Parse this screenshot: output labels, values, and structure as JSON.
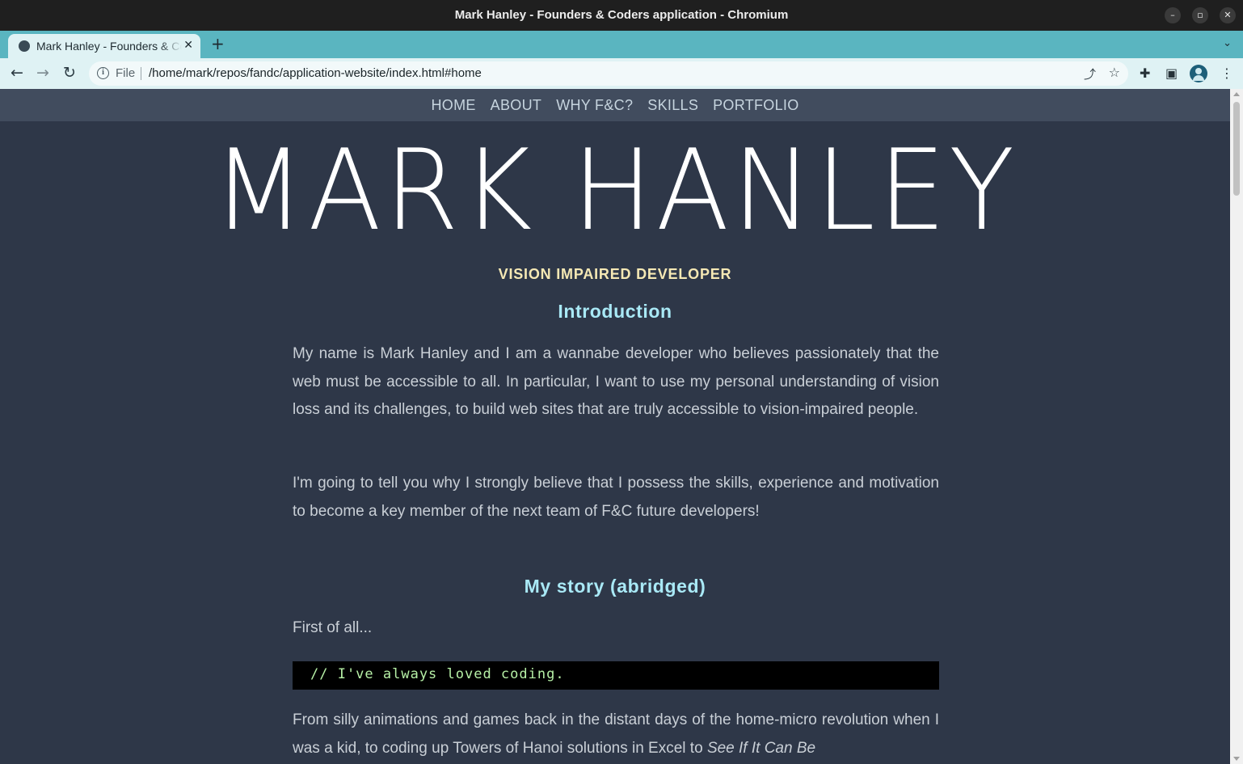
{
  "window": {
    "title": "Mark Hanley - Founders & Coders application - Chromium",
    "minimize_glyph": "–",
    "maximize_glyph": "▫",
    "close_glyph": "✕"
  },
  "tabs": [
    {
      "label": "Mark Hanley - Founders & Coders application",
      "close_glyph": "✕"
    }
  ],
  "tabstrip": {
    "new_tab_glyph": "+",
    "tab_search_glyph": "⌄"
  },
  "toolbar": {
    "back_glyph": "←",
    "forward_glyph": "→",
    "reload_glyph": "↻",
    "scheme_label": "File",
    "url": "/home/mark/repos/fandc/application-website/index.html#home",
    "share_glyph": "⤴",
    "bookmark_glyph": "☆",
    "extensions_glyph": "✚",
    "sidepanel_glyph": "▣",
    "menu_glyph": "⋮"
  },
  "site_nav": {
    "items": [
      "HOME",
      "ABOUT",
      "WHY F&C?",
      "SKILLS",
      "PORTFOLIO"
    ]
  },
  "hero": {
    "name": "MARK HANLEY",
    "subtitle": "VISION IMPAIRED DEVELOPER"
  },
  "intro": {
    "heading": "Introduction",
    "paragraph_1": "My name is Mark Hanley and I am a wannabe developer who believes passionately that the web must be accessible to all. In particular, I want to use my personal understanding of vision loss and its challenges, to build web sites that are truly accessible to vision-impaired people.",
    "paragraph_2": "I'm going to tell you why I strongly believe that I possess the skills, experience and motivation to become a key member of the next team of F&C future developers!"
  },
  "story": {
    "heading": "My story (abridged)",
    "lead": "First of all...",
    "code": "// I've always loved coding.",
    "paragraph_start": "From silly animations and games back in the distant days of the home-micro revolution when I was a kid, to coding up Towers of Hanoi solutions in Excel to ",
    "paragraph_italic": "See If It Can Be"
  },
  "colors": {
    "page_bg": "#2e3748",
    "nav_bg": "#414c5e",
    "heading": "#a9e9f6",
    "subtitle": "#f5e8b4",
    "code_text": "#b6f0a6",
    "tab_strip": "#5ab5c0"
  }
}
